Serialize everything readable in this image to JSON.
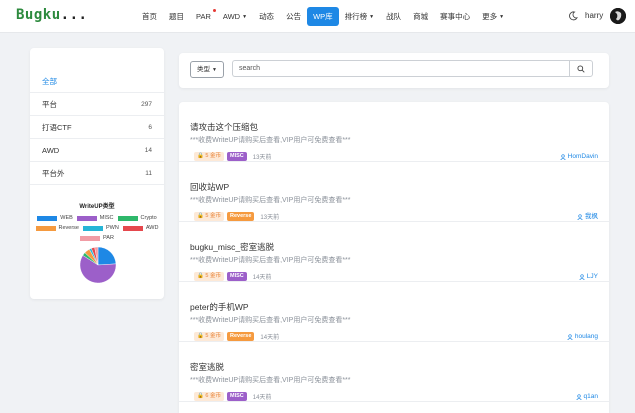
{
  "navbar": {
    "logo": "Bugku",
    "logo_dots": "...",
    "items": [
      {
        "label": "首页"
      },
      {
        "label": "题目"
      },
      {
        "label": "PAR"
      },
      {
        "label": "AWD"
      },
      {
        "label": "动态"
      },
      {
        "label": "公告"
      },
      {
        "label": "WP库"
      },
      {
        "label": "排行榜"
      },
      {
        "label": "战队"
      },
      {
        "label": "商城"
      },
      {
        "label": "赛事中心"
      },
      {
        "label": "更多"
      }
    ],
    "active": "WP库",
    "username": "harry",
    "icons": [
      "moon-icon",
      "avatar"
    ]
  },
  "sidebar": {
    "categories": [
      {
        "label": "全部",
        "count": ""
      },
      {
        "label": "平台",
        "count": "297"
      },
      {
        "label": "打语CTF",
        "count": "6"
      },
      {
        "label": "AWD",
        "count": "14"
      },
      {
        "label": "平台外",
        "count": "11"
      }
    ],
    "chart_title": "WriteUP类型",
    "legend": [
      {
        "label": "WEB",
        "color": "#1e88e5"
      },
      {
        "label": "MISC",
        "color": "#9c5fc9"
      },
      {
        "label": "Crypto",
        "color": "#2eb86b"
      },
      {
        "label": "Reverse",
        "color": "#f59a3f"
      },
      {
        "label": "PWN",
        "color": "#26b5d6"
      },
      {
        "label": "AWD",
        "color": "#e5484d"
      },
      {
        "label": "PAR",
        "color": "#f19ca5"
      }
    ]
  },
  "chart_data": {
    "type": "pie",
    "title": "WriteUP类型",
    "categories": [
      "WEB",
      "MISC",
      "Crypto",
      "Reverse",
      "PWN",
      "AWD",
      "PAR"
    ],
    "values": [
      24,
      60,
      3,
      5,
      2,
      3,
      3
    ]
  },
  "filter": {
    "type_button": "类型",
    "search_placeholder": "search",
    "search_value": ""
  },
  "writeups": [
    {
      "title": "请攻击这个压缩包",
      "desc": "***收费WriteUP请购买后查看,VIP用户可免费查看***",
      "coins": "5 金币",
      "tag": "MISC",
      "tag_color": "#9c5fc9",
      "time": "13天前",
      "author": "HomDavin"
    },
    {
      "title": "回收站WP",
      "desc": "***收费WriteUP请购买后查看,VIP用户可免费查看***",
      "coins": "5 金币",
      "tag": "Reverse",
      "tag_color": "#f59a3f",
      "time": "13天前",
      "author": "我枫"
    },
    {
      "title": "bugku_misc_密室逃脱",
      "desc": "***收费WriteUP请购买后查看,VIP用户可免费查看***",
      "coins": "5 金币",
      "tag": "MISC",
      "tag_color": "#9c5fc9",
      "time": "14天前",
      "author": "LJY"
    },
    {
      "title": "peter的手机WP",
      "desc": "***收费WriteUP请购买后查看,VIP用户可免费查看***",
      "coins": "5 金币",
      "tag": "Reverse",
      "tag_color": "#f59a3f",
      "time": "14天前",
      "author": "houlang"
    },
    {
      "title": "密室逃脱",
      "desc": "***收费WriteUP请购买后查看,VIP用户可免费查看***",
      "coins": "6 金币",
      "tag": "MISC",
      "tag_color": "#9c5fc9",
      "time": "14天前",
      "author": "q1an"
    }
  ]
}
